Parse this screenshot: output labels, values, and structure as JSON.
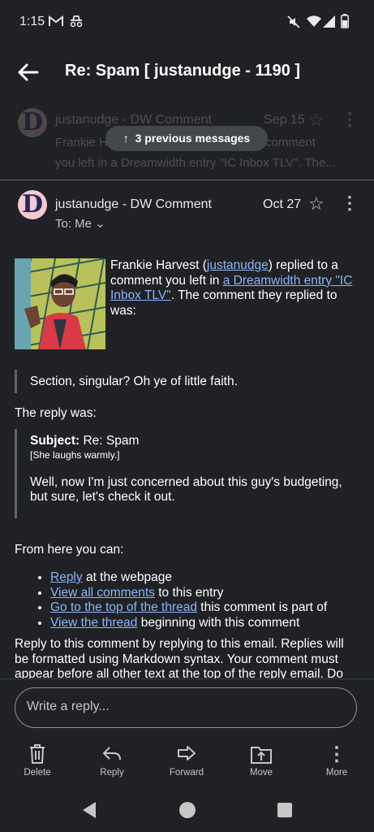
{
  "status_bar": {
    "time": "1:15",
    "icons": [
      "gmail-icon",
      "incognito-icon",
      "mute-icon",
      "wifi-icon",
      "signal-icon",
      "battery-icon"
    ]
  },
  "app_bar": {
    "subject": "Re: Spam [ justanudge - 1190 ]"
  },
  "collapsed_message": {
    "sender": "justanudge - DW Comment",
    "date": "Sep 15",
    "snippet": "Frankie H... to a comment you left in a Dreamwidth entry \"IC Inbox TLV\". The...",
    "snippet_line1_a": "Frankie H",
    "snippet_line1_b": "to a comment",
    "snippet_line2": "you left in a Dreamwidth entry \"IC Inbox TLV\". The...",
    "previous_messages": "3 previous messages"
  },
  "message": {
    "sender": "justanudge - DW Comment",
    "date": "Oct 27",
    "to": "To: Me",
    "avatar_letter": "D",
    "intro_1": "Frankie Harvest (",
    "intro_link_user": "justanudge",
    "intro_2": ") replied to a comment you left in ",
    "intro_link_entry": "a Dreamwidth entry \"IC Inbox TLV\"",
    "intro_3": ". The comment they replied to was:",
    "quoted_comment": "Section, singular? Oh ye of little faith.",
    "reply_was": "The reply was:",
    "reply_subject_label": "Subject:",
    "reply_subject": "Re: Spam",
    "reply_action": "[She laughs warmly.]",
    "reply_text": "Well, now I'm just concerned about this guy's budgeting, but sure, let's check it out.",
    "from_here": "From here you can:",
    "options": [
      {
        "link": "Reply",
        "rest": " at the webpage"
      },
      {
        "link": "View all comments",
        "rest": " to this entry"
      },
      {
        "link": "Go to the top of the thread",
        "rest": " this comment is part of"
      },
      {
        "link": "View the thread",
        "rest": " beginning with this comment"
      }
    ],
    "footer": "Reply to this comment by replying to this email. Replies will be formatted using Markdown syntax. Your comment must appear before all other text at the top of the reply email. Do not change the reply-to address. It uses a secret address to"
  },
  "compose": {
    "placeholder": "Write a reply..."
  },
  "actions": [
    {
      "label": "Delete",
      "icon": "trash-icon"
    },
    {
      "label": "Reply",
      "icon": "reply-icon"
    },
    {
      "label": "Forward",
      "icon": "forward-icon"
    },
    {
      "label": "Move",
      "icon": "move-icon"
    },
    {
      "label": "More",
      "icon": "more-icon"
    }
  ],
  "nav": [
    "back-nav-icon",
    "home-nav-icon",
    "recents-nav-icon"
  ]
}
